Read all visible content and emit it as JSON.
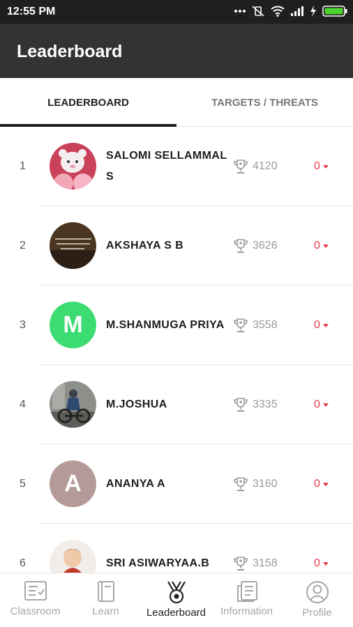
{
  "status_bar": {
    "time": "12:55 PM"
  },
  "app_bar": {
    "title": "Leaderboard"
  },
  "tabs": [
    {
      "label": "LEADERBOARD",
      "active": true
    },
    {
      "label": "TARGETS / THREATS",
      "active": false
    }
  ],
  "leaderboard": [
    {
      "rank": "1",
      "name": "SALOMI SELLAMMAL S",
      "score": "4120",
      "change": "0",
      "avatar": "photo-toy"
    },
    {
      "rank": "2",
      "name": "AKSHAYA S B",
      "score": "3626",
      "change": "0",
      "avatar": "photo-quote"
    },
    {
      "rank": "3",
      "name": "M.SHANMUGA PRIYA",
      "score": "3558",
      "change": "0",
      "avatar": "M",
      "avatar_color": "#3ddc73"
    },
    {
      "rank": "4",
      "name": "M.JOSHUA",
      "score": "3335",
      "change": "0",
      "avatar": "photo-bike"
    },
    {
      "rank": "5",
      "name": "ANANYA A",
      "score": "3160",
      "change": "0",
      "avatar": "A",
      "avatar_color": "#b49b99"
    },
    {
      "rank": "6",
      "name": "SRI ASIWARYAA.B",
      "score": "3158",
      "change": "0",
      "avatar": "photo-baby"
    }
  ],
  "bottom_nav": [
    {
      "label": "Classroom",
      "icon": "classroom-icon",
      "active": false
    },
    {
      "label": "Learn",
      "icon": "book-icon",
      "active": false
    },
    {
      "label": "Leaderboard",
      "icon": "medal-icon",
      "active": true
    },
    {
      "label": "Information",
      "icon": "document-icon",
      "active": false
    },
    {
      "label": "Profile",
      "icon": "profile-icon",
      "active": false
    }
  ],
  "colors": {
    "app_bar": "#333333",
    "status_bar": "#1f1f1f",
    "change_red": "#e8394a"
  }
}
